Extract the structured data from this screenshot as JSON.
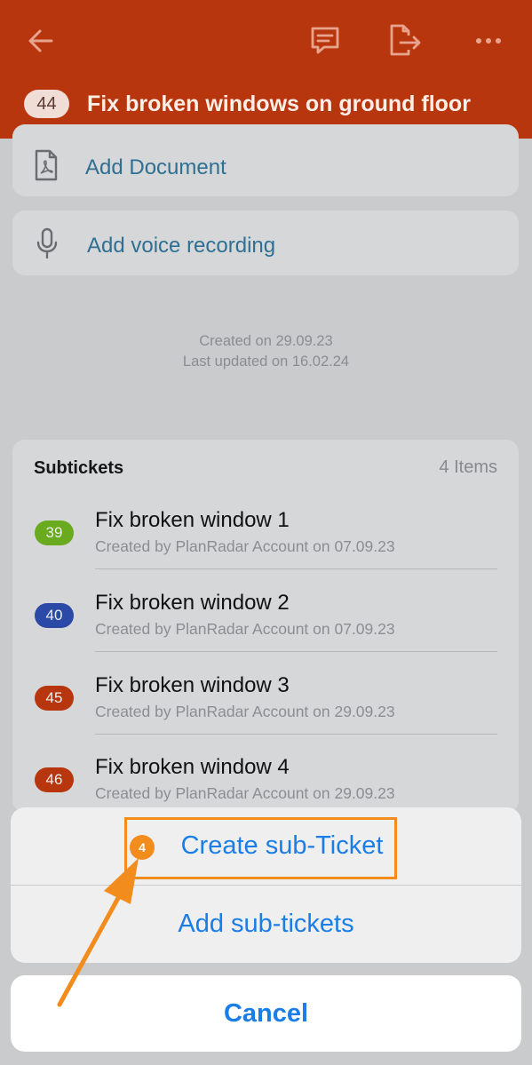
{
  "header": {
    "ticket_number": "44",
    "title": "Fix broken windows on ground floor",
    "icons": [
      "back-arrow-icon",
      "comment-icon",
      "export-icon",
      "more-icon"
    ],
    "background_color": "#b8360d"
  },
  "attachments": [
    {
      "label": "Add Document",
      "icon": "pdf-document-icon"
    },
    {
      "label": "Add voice recording",
      "icon": "microphone-icon"
    }
  ],
  "meta": {
    "created": "Created on 29.09.23",
    "updated": "Last updated on 16.02.24"
  },
  "subtickets": {
    "title": "Subtickets",
    "count": "4 Items",
    "items": [
      {
        "number": "39",
        "color": "#6aaa1e",
        "title": "Fix broken window 1",
        "subtitle": "Created by PlanRadar Account on 07.09.23"
      },
      {
        "number": "40",
        "color": "#2b49a6",
        "title": "Fix broken window 2",
        "subtitle": "Created by PlanRadar Account on 07.09.23"
      },
      {
        "number": "45",
        "color": "#b8360d",
        "title": "Fix broken window 3",
        "subtitle": "Created by PlanRadar Account on 29.09.23"
      },
      {
        "number": "46",
        "color": "#b8360d",
        "title": "Fix broken window 4",
        "subtitle": "Created by PlanRadar Account on 29.09.23"
      }
    ]
  },
  "action_sheet": {
    "step_number": "4",
    "create_label": "Create sub-Ticket",
    "add_label": "Add sub-tickets",
    "cancel_label": "Cancel",
    "accent_color": "#1a7ee6",
    "highlight_color": "#f28c1c"
  }
}
